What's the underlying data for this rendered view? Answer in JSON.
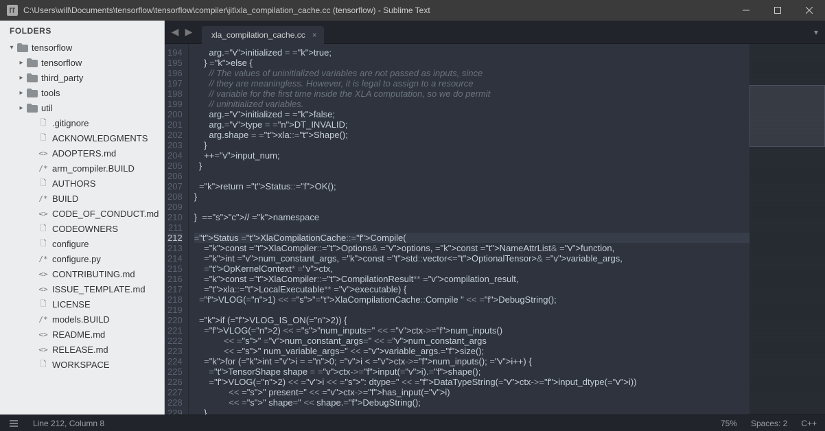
{
  "window": {
    "title": "C:\\Users\\will\\Documents\\tensorflow\\tensorflow\\compiler\\jit\\xla_compilation_cache.cc (tensorflow) - Sublime Text"
  },
  "sidebar": {
    "header": "FOLDERS",
    "root": {
      "name": "tensorflow",
      "expanded": true
    },
    "folders": [
      {
        "name": "tensorflow"
      },
      {
        "name": "third_party"
      },
      {
        "name": "tools"
      },
      {
        "name": "util"
      }
    ],
    "files": [
      {
        "name": ".gitignore",
        "icon": "doc"
      },
      {
        "name": "ACKNOWLEDGMENTS",
        "icon": "doc"
      },
      {
        "name": "ADOPTERS.md",
        "icon": "md"
      },
      {
        "name": "arm_compiler.BUILD",
        "icon": "code"
      },
      {
        "name": "AUTHORS",
        "icon": "doc"
      },
      {
        "name": "BUILD",
        "icon": "code"
      },
      {
        "name": "CODE_OF_CONDUCT.md",
        "icon": "md"
      },
      {
        "name": "CODEOWNERS",
        "icon": "doc"
      },
      {
        "name": "configure",
        "icon": "doc"
      },
      {
        "name": "configure.py",
        "icon": "code"
      },
      {
        "name": "CONTRIBUTING.md",
        "icon": "md"
      },
      {
        "name": "ISSUE_TEMPLATE.md",
        "icon": "md"
      },
      {
        "name": "LICENSE",
        "icon": "doc"
      },
      {
        "name": "models.BUILD",
        "icon": "code"
      },
      {
        "name": "README.md",
        "icon": "md"
      },
      {
        "name": "RELEASE.md",
        "icon": "md"
      },
      {
        "name": "WORKSPACE",
        "icon": "doc"
      }
    ]
  },
  "tabs": {
    "active": {
      "label": "xla_compilation_cache.cc"
    }
  },
  "editor": {
    "first_line": 194,
    "current_line": 212,
    "lines": [
      "      arg.initialized = true;",
      "    } else {",
      "      // The values of uninitialized variables are not passed as inputs, since",
      "      // they are meaningless. However, it is legal to assign to a resource",
      "      // variable for the first time inside the XLA computation, so we do permit",
      "      // uninitialized variables.",
      "      arg.initialized = false;",
      "      arg.type = DT_INVALID;",
      "      arg.shape = xla::Shape();",
      "    }",
      "    ++input_num;",
      "  }",
      "",
      "  return Status::OK();",
      "}",
      "",
      "}  // namespace",
      "",
      "Status XlaCompilationCache::Compile(",
      "    const XlaCompiler::Options& options, const NameAttrList& function,",
      "    int num_constant_args, const std::vector<OptionalTensor>& variable_args,",
      "    OpKernelContext* ctx,",
      "    const XlaCompiler::CompilationResult** compilation_result,",
      "    xla::LocalExecutable** executable) {",
      "  VLOG(1) << \"XlaCompilationCache::Compile \" << DebugString();",
      "",
      "  if (VLOG_IS_ON(2)) {",
      "    VLOG(2) << \"num_inputs=\" << ctx->num_inputs()",
      "            << \" num_constant_args=\" << num_constant_args",
      "            << \" num_variable_args=\" << variable_args.size();",
      "    for (int i = 0; i < ctx->num_inputs(); i++) {",
      "      TensorShape shape = ctx->input(i).shape();",
      "      VLOG(2) << i << \": dtype=\" << DataTypeString(ctx->input_dtype(i))",
      "              << \" present=\" << ctx->has_input(i)",
      "              << \" shape=\" << shape.DebugString();",
      "    }"
    ]
  },
  "status": {
    "position": "Line 212, Column 8",
    "zoom": "75%",
    "spaces": "Spaces: 2",
    "lang": "C++"
  }
}
